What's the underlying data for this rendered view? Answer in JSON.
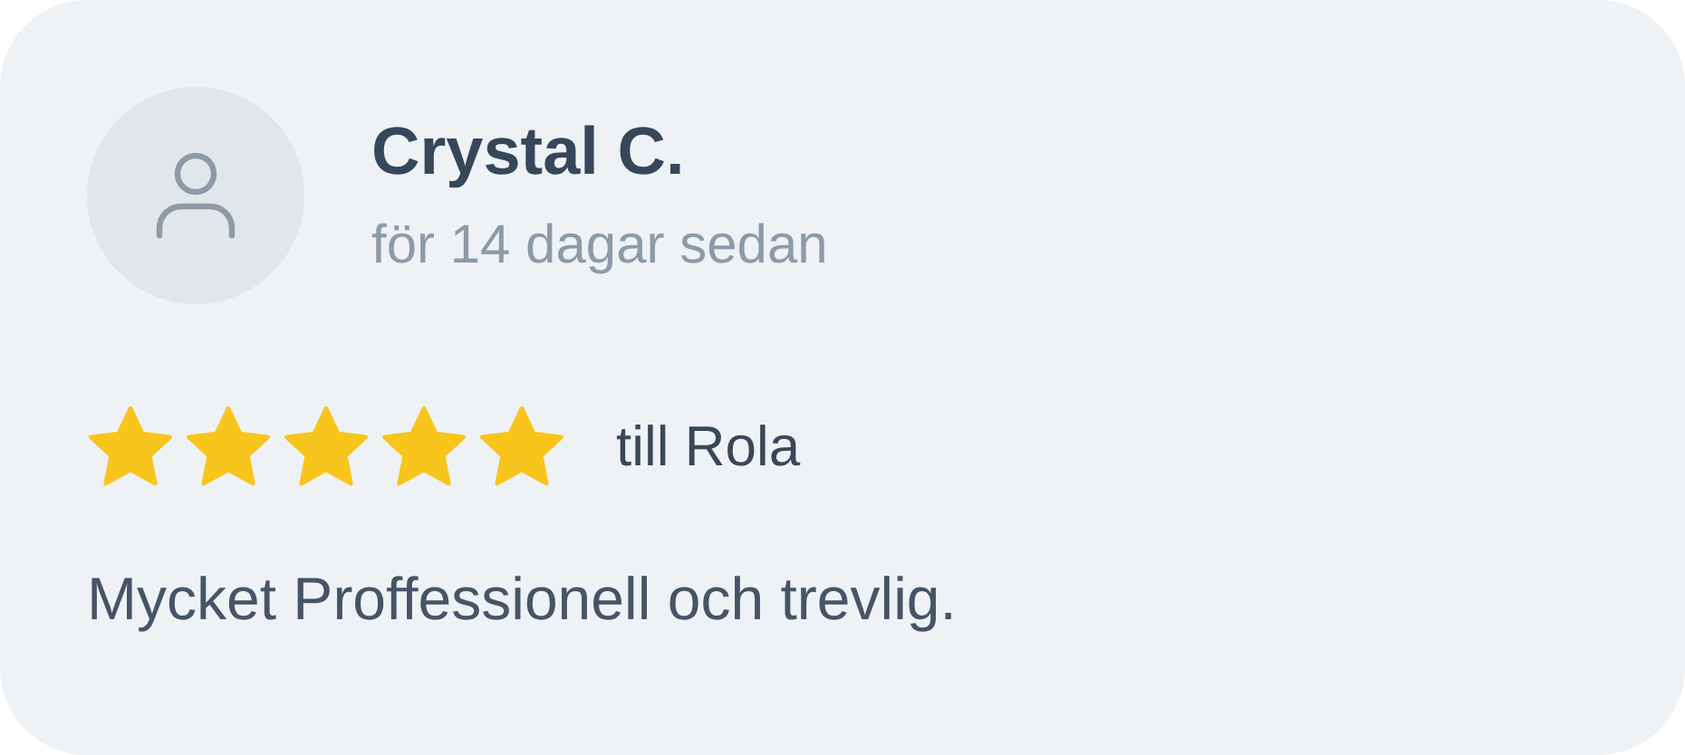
{
  "review": {
    "author": "Crystal C.",
    "time": "för 14 dagar sedan",
    "stars": 5,
    "recipient": "till Rola",
    "text": "Mycket Proffessionell och trevlig."
  }
}
